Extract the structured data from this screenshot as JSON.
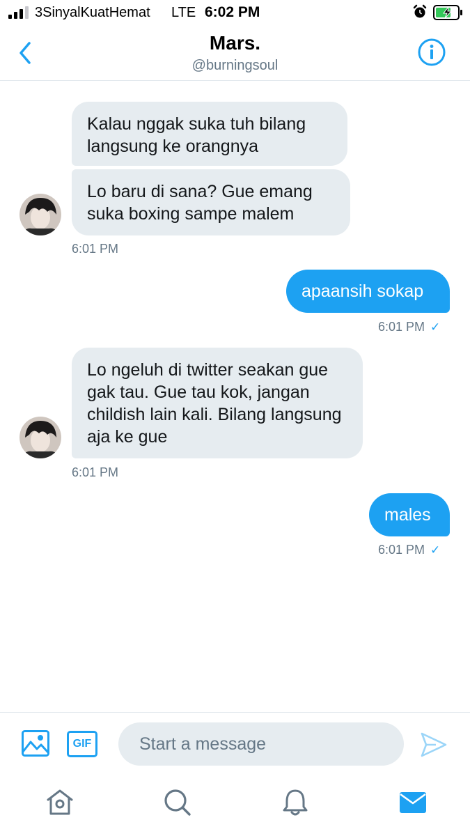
{
  "status_bar": {
    "carrier": "3SinyalKuatHemat",
    "network": "LTE",
    "time": "6:02 PM"
  },
  "header": {
    "name": "Mars.",
    "handle": "@burningsoul"
  },
  "messages": [
    {
      "direction": "incoming",
      "text": "Kalau nggak suka tuh bilang langsung ke orangnya"
    },
    {
      "direction": "incoming",
      "text": "Lo baru di sana? Gue emang suka boxing sampe malem",
      "timestamp": "6:01 PM"
    },
    {
      "direction": "outgoing",
      "text": "apaansih sokap",
      "timestamp": "6:01 PM",
      "read_check": "✓"
    },
    {
      "direction": "incoming",
      "text": "Lo ngeluh di twitter seakan gue gak tau. Gue tau kok, jangan childish lain kali. Bilang langsung aja ke gue",
      "timestamp": "6:01 PM"
    },
    {
      "direction": "outgoing",
      "text": "males",
      "timestamp": "6:01 PM",
      "read_check": "✓"
    }
  ],
  "composer": {
    "gif_label": "GIF",
    "placeholder": "Start a message",
    "value": ""
  },
  "icons": {
    "back": "chevron-left-icon",
    "info": "info-icon",
    "image": "image-icon",
    "send": "send-icon",
    "home": "home-icon",
    "search": "search-icon",
    "notifications": "bell-icon",
    "messages": "mail-icon"
  },
  "colors": {
    "accent": "#1da1f2",
    "incoming_bubble": "#e6ecf0",
    "secondary_text": "#657786"
  }
}
